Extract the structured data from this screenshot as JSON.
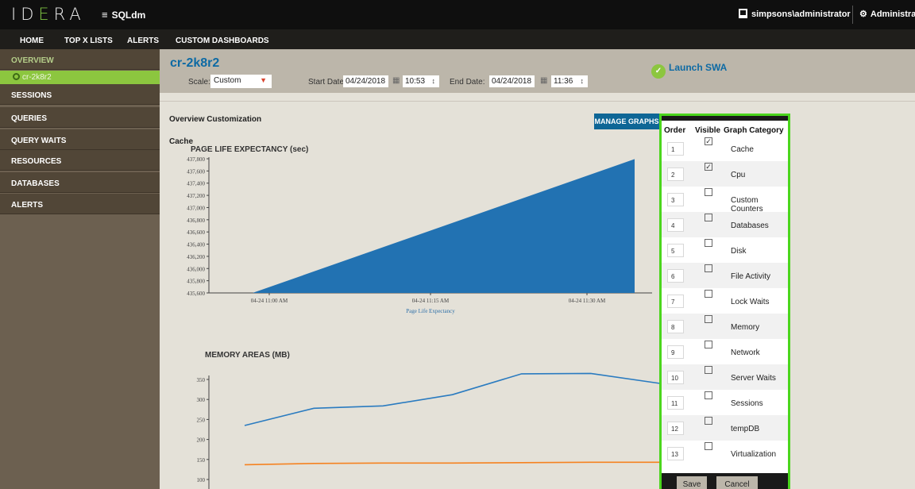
{
  "app": {
    "logo": {
      "left": "ID",
      "mid": "E",
      "right": "RA"
    },
    "menu_icon": "hamburger-icon",
    "name": "SQLdm",
    "user": "simpsons\\administrator",
    "admin": "Administration"
  },
  "nav": {
    "items": [
      "HOME",
      "TOP X LISTS",
      "ALERTS",
      "CUSTOM DASHBOARDS"
    ]
  },
  "sidebar": {
    "overview": "OVERVIEW",
    "selected_server": "cr-2k8r2",
    "items": [
      "SESSIONS",
      "QUERIES",
      "QUERY WAITS",
      "RESOURCES",
      "DATABASES",
      "ALERTS"
    ]
  },
  "header": {
    "title": "cr-2k8r2",
    "scale_label": "Scale:",
    "scale_value": "Custom",
    "start_label": "Start Date:",
    "start_date": "04/24/2018",
    "start_time": "10:53",
    "end_label": "End Date:",
    "end_date": "04/24/2018",
    "end_time": "11:36",
    "launch_swa": "Launch SWA",
    "colors": {
      "accent": "#0d6aa4",
      "green": "#8cc63f"
    }
  },
  "main": {
    "section_title": "Overview Customization",
    "manage_graphs": "MANAGE GRAPHS",
    "category": "Cache"
  },
  "chart_data": [
    {
      "type": "area",
      "title": "PAGE LIFE EXPECTANCY (sec)",
      "legend": [
        "Page Life Expectancy"
      ],
      "yticks": [
        "437,800",
        "437,600",
        "437,400",
        "437,200",
        "437,000",
        "436,800",
        "436,600",
        "436,400",
        "436,200",
        "436,000",
        "435,800",
        "435,600"
      ],
      "xticks": [
        "04-24 11:00 AM",
        "04-24 11:15 AM",
        "04-24 11:30 AM"
      ],
      "ylim": [
        435600,
        437850
      ],
      "series": [
        {
          "name": "Page Life Expectancy",
          "color": "#2272b2",
          "x": [
            "10:53",
            "11:36"
          ],
          "values": [
            435560,
            437845
          ]
        }
      ]
    },
    {
      "type": "line",
      "title": "MEMORY AREAS (MB)",
      "yticks": [
        "350",
        "300",
        "250",
        "200",
        "150",
        "100"
      ],
      "series": [
        {
          "color": "#2a7bc0",
          "values": [
            235,
            278,
            284,
            312,
            364,
            365,
            340
          ]
        },
        {
          "color": "#f58220",
          "values": [
            137,
            140,
            141,
            141,
            142,
            143,
            143
          ]
        }
      ]
    }
  ],
  "panel": {
    "headers": {
      "order": "Order",
      "visible": "Visible",
      "category": "Graph Category"
    },
    "rows": [
      {
        "order": "1",
        "visible": true,
        "category": "Cache"
      },
      {
        "order": "2",
        "visible": true,
        "category": "Cpu"
      },
      {
        "order": "3",
        "visible": false,
        "category": "Custom Counters"
      },
      {
        "order": "4",
        "visible": false,
        "category": "Databases"
      },
      {
        "order": "5",
        "visible": false,
        "category": "Disk"
      },
      {
        "order": "6",
        "visible": false,
        "category": "File Activity"
      },
      {
        "order": "7",
        "visible": false,
        "category": "Lock Waits"
      },
      {
        "order": "8",
        "visible": false,
        "category": "Memory"
      },
      {
        "order": "9",
        "visible": false,
        "category": "Network"
      },
      {
        "order": "10",
        "visible": false,
        "category": "Server Waits"
      },
      {
        "order": "11",
        "visible": false,
        "category": "Sessions"
      },
      {
        "order": "12",
        "visible": false,
        "category": "tempDB"
      },
      {
        "order": "13",
        "visible": false,
        "category": "Virtualization"
      }
    ],
    "save": "Save",
    "cancel": "Cancel"
  }
}
